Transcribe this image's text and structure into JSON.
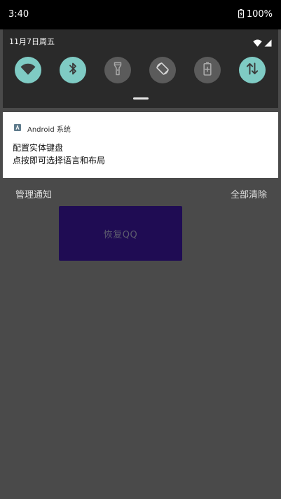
{
  "status_bar": {
    "time": "3:40",
    "battery_text": "100%",
    "battery_icon": "battery-charging-icon"
  },
  "quick_settings": {
    "date": "11月7日周五",
    "tiles": [
      {
        "name": "wifi",
        "state": "on",
        "icon": "wifi-icon"
      },
      {
        "name": "bluetooth",
        "state": "on",
        "icon": "bluetooth-icon"
      },
      {
        "name": "flashlight",
        "state": "off",
        "icon": "flashlight-icon"
      },
      {
        "name": "auto-rotate",
        "state": "off",
        "icon": "rotate-icon"
      },
      {
        "name": "battery-saver",
        "state": "off",
        "icon": "battery-saver-icon"
      },
      {
        "name": "mobile-data",
        "state": "on",
        "icon": "data-transfer-icon"
      }
    ],
    "active_color": "#7fcbc4",
    "inactive_color": "#5b5b5b"
  },
  "notification": {
    "app_name": "Android 系统",
    "title": "配置实体键盘",
    "text": "点按即可选择语言和布局"
  },
  "footer": {
    "manage_label": "管理通知",
    "clear_label": "全部清除"
  },
  "background_app": {
    "button_label": "恢复QQ",
    "button_color": "#1f0c53"
  }
}
